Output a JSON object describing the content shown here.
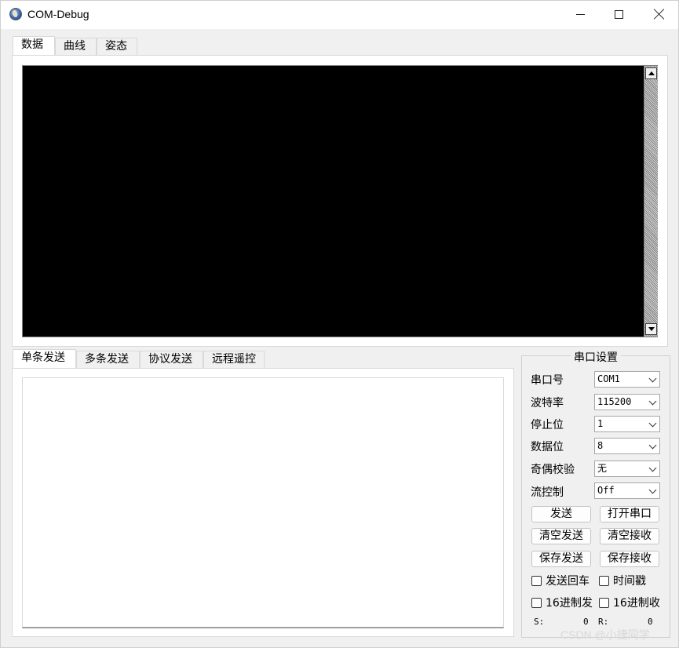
{
  "window": {
    "title": "COM-Debug"
  },
  "top_tabs": [
    {
      "label": "数据",
      "active": true
    },
    {
      "label": "曲线",
      "active": false
    },
    {
      "label": "姿态",
      "active": false
    }
  ],
  "bottom_tabs": [
    {
      "label": "单条发送",
      "active": true
    },
    {
      "label": "多条发送",
      "active": false
    },
    {
      "label": "协议发送",
      "active": false
    },
    {
      "label": "远程遥控",
      "active": false
    }
  ],
  "serial": {
    "title": "串口设置",
    "port": {
      "label": "串口号",
      "value": "COM1"
    },
    "baud": {
      "label": "波特率",
      "value": "115200"
    },
    "stop": {
      "label": "停止位",
      "value": "1"
    },
    "data_bits": {
      "label": "数据位",
      "value": "8"
    },
    "parity": {
      "label": "奇偶校验",
      "value": "无"
    },
    "flow": {
      "label": "流控制",
      "value": "Off"
    },
    "buttons": {
      "send": "发送",
      "open_port": "打开串口",
      "clear_send": "清空发送",
      "clear_recv": "清空接收",
      "save_send": "保存发送",
      "save_recv": "保存接收"
    },
    "checks": {
      "send_crlf": "发送回车",
      "timestamp": "时间戳",
      "hex_send": "16进制发",
      "hex_recv": "16进制收"
    },
    "counters": {
      "s_label": "S:",
      "s_value": "0",
      "r_label": "R:",
      "r_value": "0"
    }
  },
  "watermark": "CSDN @小捷同学"
}
